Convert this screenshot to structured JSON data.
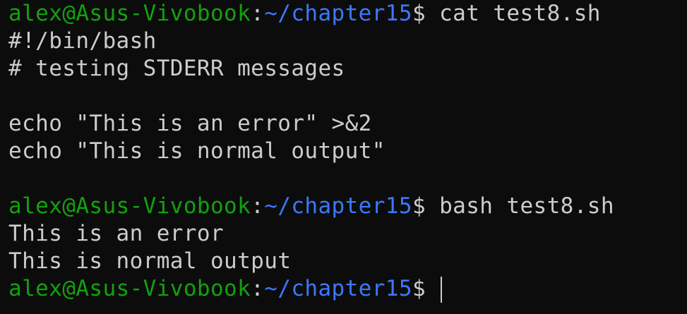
{
  "colors": {
    "background": "#0c0c0c",
    "text": "#cccccc",
    "prompt_user": "#13a10e",
    "prompt_path": "#3b78ff"
  },
  "prompt": {
    "user_host": "alex@Asus-Vivobook",
    "colon": ":",
    "path": "~/chapter15",
    "symbol": "$ "
  },
  "lines": [
    {
      "type": "prompt",
      "command": "cat test8.sh"
    },
    {
      "type": "output",
      "text": "#!/bin/bash"
    },
    {
      "type": "output",
      "text": "# testing STDERR messages"
    },
    {
      "type": "output",
      "text": ""
    },
    {
      "type": "output",
      "text": "echo \"This is an error\" >&2"
    },
    {
      "type": "output",
      "text": "echo \"This is normal output\""
    },
    {
      "type": "output",
      "text": ""
    },
    {
      "type": "prompt",
      "command": "bash test8.sh"
    },
    {
      "type": "output",
      "text": "This is an error"
    },
    {
      "type": "output",
      "text": "This is normal output"
    },
    {
      "type": "prompt",
      "command": ""
    }
  ]
}
